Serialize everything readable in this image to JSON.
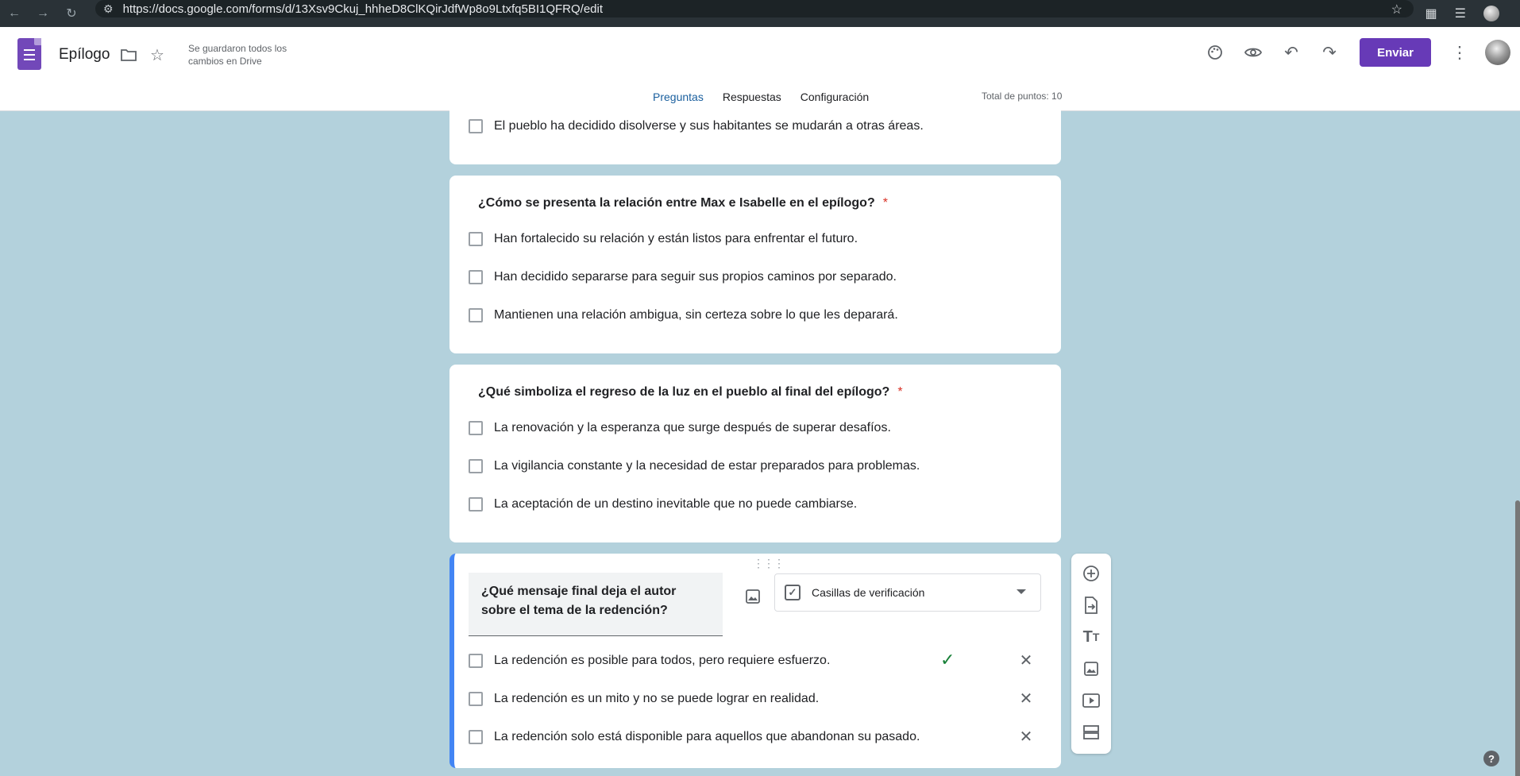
{
  "browser": {
    "url": "https://docs.google.com/forms/d/13Xsv9Ckuj_hhheD8ClKQirJdfWp8o9Ltxfq5BI1QFRQ/edit",
    "back_icon": "arrow-left-icon",
    "forward_icon": "arrow-right-icon",
    "reload_icon": "reload-icon"
  },
  "header": {
    "title": "Epílogo",
    "save_status": "Se guardaron todos los cambios en Drive",
    "send_label": "Enviar",
    "brand_color": "#673ab7"
  },
  "tabs": [
    {
      "label": "Preguntas",
      "active": true
    },
    {
      "label": "Respuestas",
      "active": false
    },
    {
      "label": "Configuración",
      "active": false
    }
  ],
  "total_points": "Total de puntos: 10",
  "questions": [
    {
      "title": "",
      "options": [
        "El pueblo ha decidido disolverse y sus habitantes se mudarán a otras áreas."
      ]
    },
    {
      "title": "¿Cómo se presenta la relación entre Max e Isabelle en el epílogo?",
      "required_mark": "*",
      "options": [
        "Han fortalecido su relación y están listos para enfrentar el futuro.",
        "Han decidido separarse para seguir sus propios caminos por separado.",
        "Mantienen una relación ambigua, sin certeza sobre lo que les deparará."
      ]
    },
    {
      "title": "¿Qué simboliza el regreso de la luz en el pueblo al final del epílogo?",
      "required_mark": "*",
      "options": [
        "La renovación y la esperanza que surge después de superar desafíos.",
        "La vigilancia constante y la necesidad de estar preparados para problemas.",
        "La aceptación de un destino inevitable que no puede cambiarse."
      ]
    },
    {
      "title": "¿Qué mensaje final deja el autor sobre el tema de la redención?",
      "type_label": "Casillas de verificación",
      "correct_index": 0,
      "options": [
        "La redención es posible para todos, pero requiere esfuerzo.",
        "La redención es un mito y no se puede lograr en realidad.",
        "La redención solo está disponible para aquellos que abandonan su pasado."
      ]
    }
  ],
  "accent_color": "#4285f4",
  "correct_color": "#188038"
}
